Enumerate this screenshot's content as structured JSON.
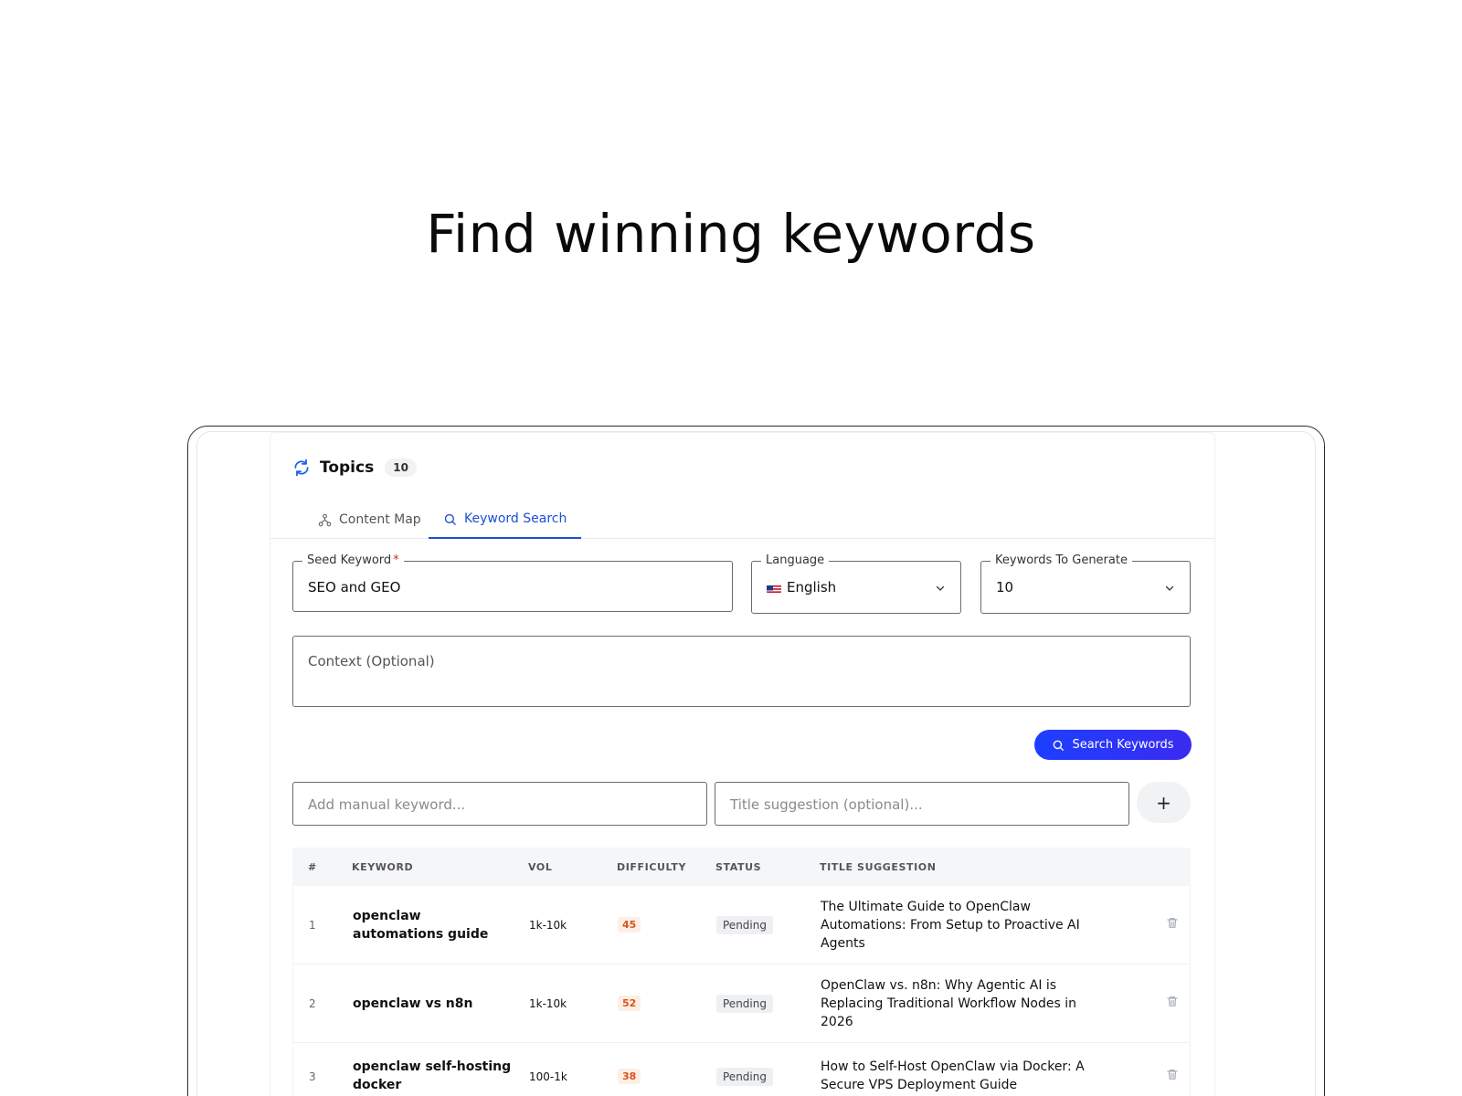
{
  "headline": "Find winning keywords",
  "topics": {
    "title": "Topics",
    "count": "10"
  },
  "tabs": [
    {
      "label": "Content Map",
      "icon": "sitemap-icon"
    },
    {
      "label": "Keyword Search",
      "icon": "search-icon",
      "active": true
    }
  ],
  "form": {
    "seed_label": "Seed Keyword",
    "seed_required": "*",
    "seed_value": "SEO and GEO",
    "language_label": "Language",
    "language_value": "English",
    "count_label": "Keywords To Generate",
    "count_value": "10",
    "context_placeholder": "Context (Optional)",
    "search_button": "Search Keywords"
  },
  "manual": {
    "keyword_placeholder": "Add manual keyword...",
    "title_placeholder": "Title suggestion (optional)...",
    "add_button": "+"
  },
  "table": {
    "headers": [
      "#",
      "KEYWORD",
      "VOL",
      "DIFFICULTY",
      "STATUS",
      "TITLE SUGGESTION"
    ],
    "rows": [
      {
        "num": "1",
        "keyword": "openclaw automations guide",
        "vol": "1k-10k",
        "difficulty": "45",
        "status": "Pending",
        "title": "The Ultimate Guide to OpenClaw Automations: From Setup to Proactive AI Agents"
      },
      {
        "num": "2",
        "keyword": "openclaw vs n8n",
        "vol": "1k-10k",
        "difficulty": "52",
        "status": "Pending",
        "title": "OpenClaw vs. n8n: Why Agentic AI is Replacing Traditional Workflow Nodes in 2026"
      },
      {
        "num": "3",
        "keyword": "openclaw self-hosting docker",
        "vol": "100-1k",
        "difficulty": "38",
        "status": "Pending",
        "title": "How to Self-Host OpenClaw via Docker: A Secure VPS Deployment Guide"
      }
    ]
  },
  "colors": {
    "accent": "#1d4ed8",
    "button": "#1d3fff",
    "difficulty": "#d9551a"
  }
}
